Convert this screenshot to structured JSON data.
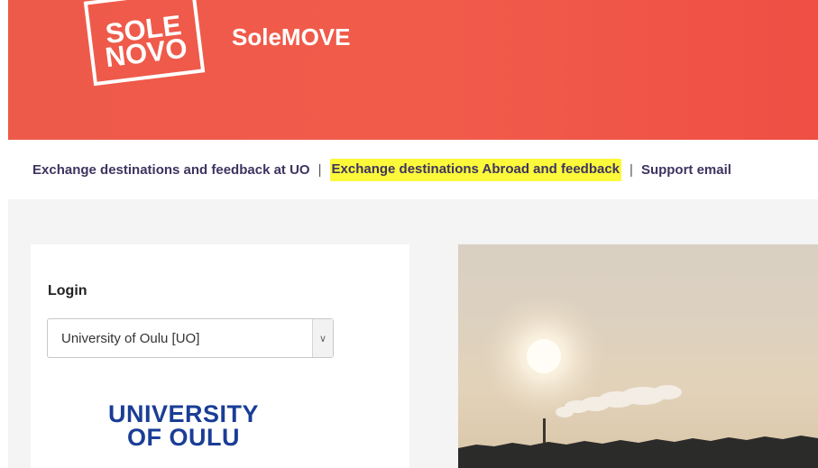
{
  "header": {
    "logo_line1": "SOLE",
    "logo_line2": "NOVO",
    "app_title": "SoleMOVE"
  },
  "nav": {
    "link1": "Exchange destinations and feedback at UO",
    "link2": "Exchange destinations Abroad and feedback",
    "link3": "Support email",
    "separator": "|",
    "highlight_color": "#fbf93a"
  },
  "login": {
    "title": "Login",
    "organization_selected": "University of Oulu [UO]"
  },
  "university_logo": {
    "line1": "UNIVERSITY",
    "line2": "OF OULU"
  },
  "colors": {
    "header": "#f15b4a",
    "nav_text": "#3f3360",
    "university_blue": "#1a3d96"
  }
}
